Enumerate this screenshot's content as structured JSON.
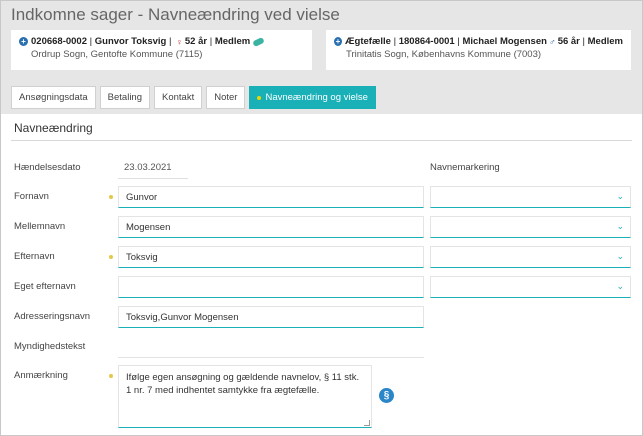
{
  "window": {
    "title": "Indkomne sager - Navneændring ved vielse"
  },
  "cards": [
    {
      "id": "020668-0002",
      "name": "Gunvor Toksvig",
      "age": "52 år",
      "status": "Medlem",
      "sex_icon": "female-icon",
      "address": "Ordrup Sogn, Gentofte Kommune (7115)",
      "color_female": "#c0392b"
    },
    {
      "role": "Ægtefælle",
      "id": "180864-0001",
      "name": "Michael Mogensen",
      "age": "56 år",
      "status": "Medlem",
      "sex_icon": "male-icon",
      "address": "Trinitatis Sogn, Københavns Kommune (7003)",
      "color_male": "#2a6fb0"
    }
  ],
  "tabs": [
    {
      "label": "Ansøgningsdata",
      "active": false
    },
    {
      "label": "Betaling",
      "active": false
    },
    {
      "label": "Kontakt",
      "active": false
    },
    {
      "label": "Noter",
      "active": false
    },
    {
      "label": "Navneændring og vielse",
      "active": true
    }
  ],
  "form": {
    "section_title": "Navneændring",
    "haendelsesdato": {
      "label": "Hændelsesdato",
      "value": "23.03.2021"
    },
    "navnemarkering_label": "Navnemarkering",
    "fornavn": {
      "label": "Fornavn",
      "value": "Gunvor",
      "required": true
    },
    "mellemnavn": {
      "label": "Mellemnavn",
      "value": "Mogensen",
      "required": false
    },
    "efternavn": {
      "label": "Efternavn",
      "value": "Toksvig",
      "required": true
    },
    "eget_efternavn": {
      "label": "Eget efternavn",
      "value": "",
      "required": false
    },
    "adresseringsnavn": {
      "label": "Adresseringsnavn",
      "value": "Toksvig,Gunvor Mogensen"
    },
    "myndighedstekst": {
      "label": "Myndighedstekst",
      "value": ""
    },
    "anmaerkning": {
      "label": "Anmærkning",
      "value": "Ifølge egen ansøgning og gældende navnelov, § 11 stk. 1 nr. 7 med indhentet samtykke fra ægtefælle.",
      "required": true
    }
  },
  "colors": {
    "accent": "#1ab0b8",
    "required_dot": "#e3c84a",
    "band": "#e6e6e6"
  }
}
